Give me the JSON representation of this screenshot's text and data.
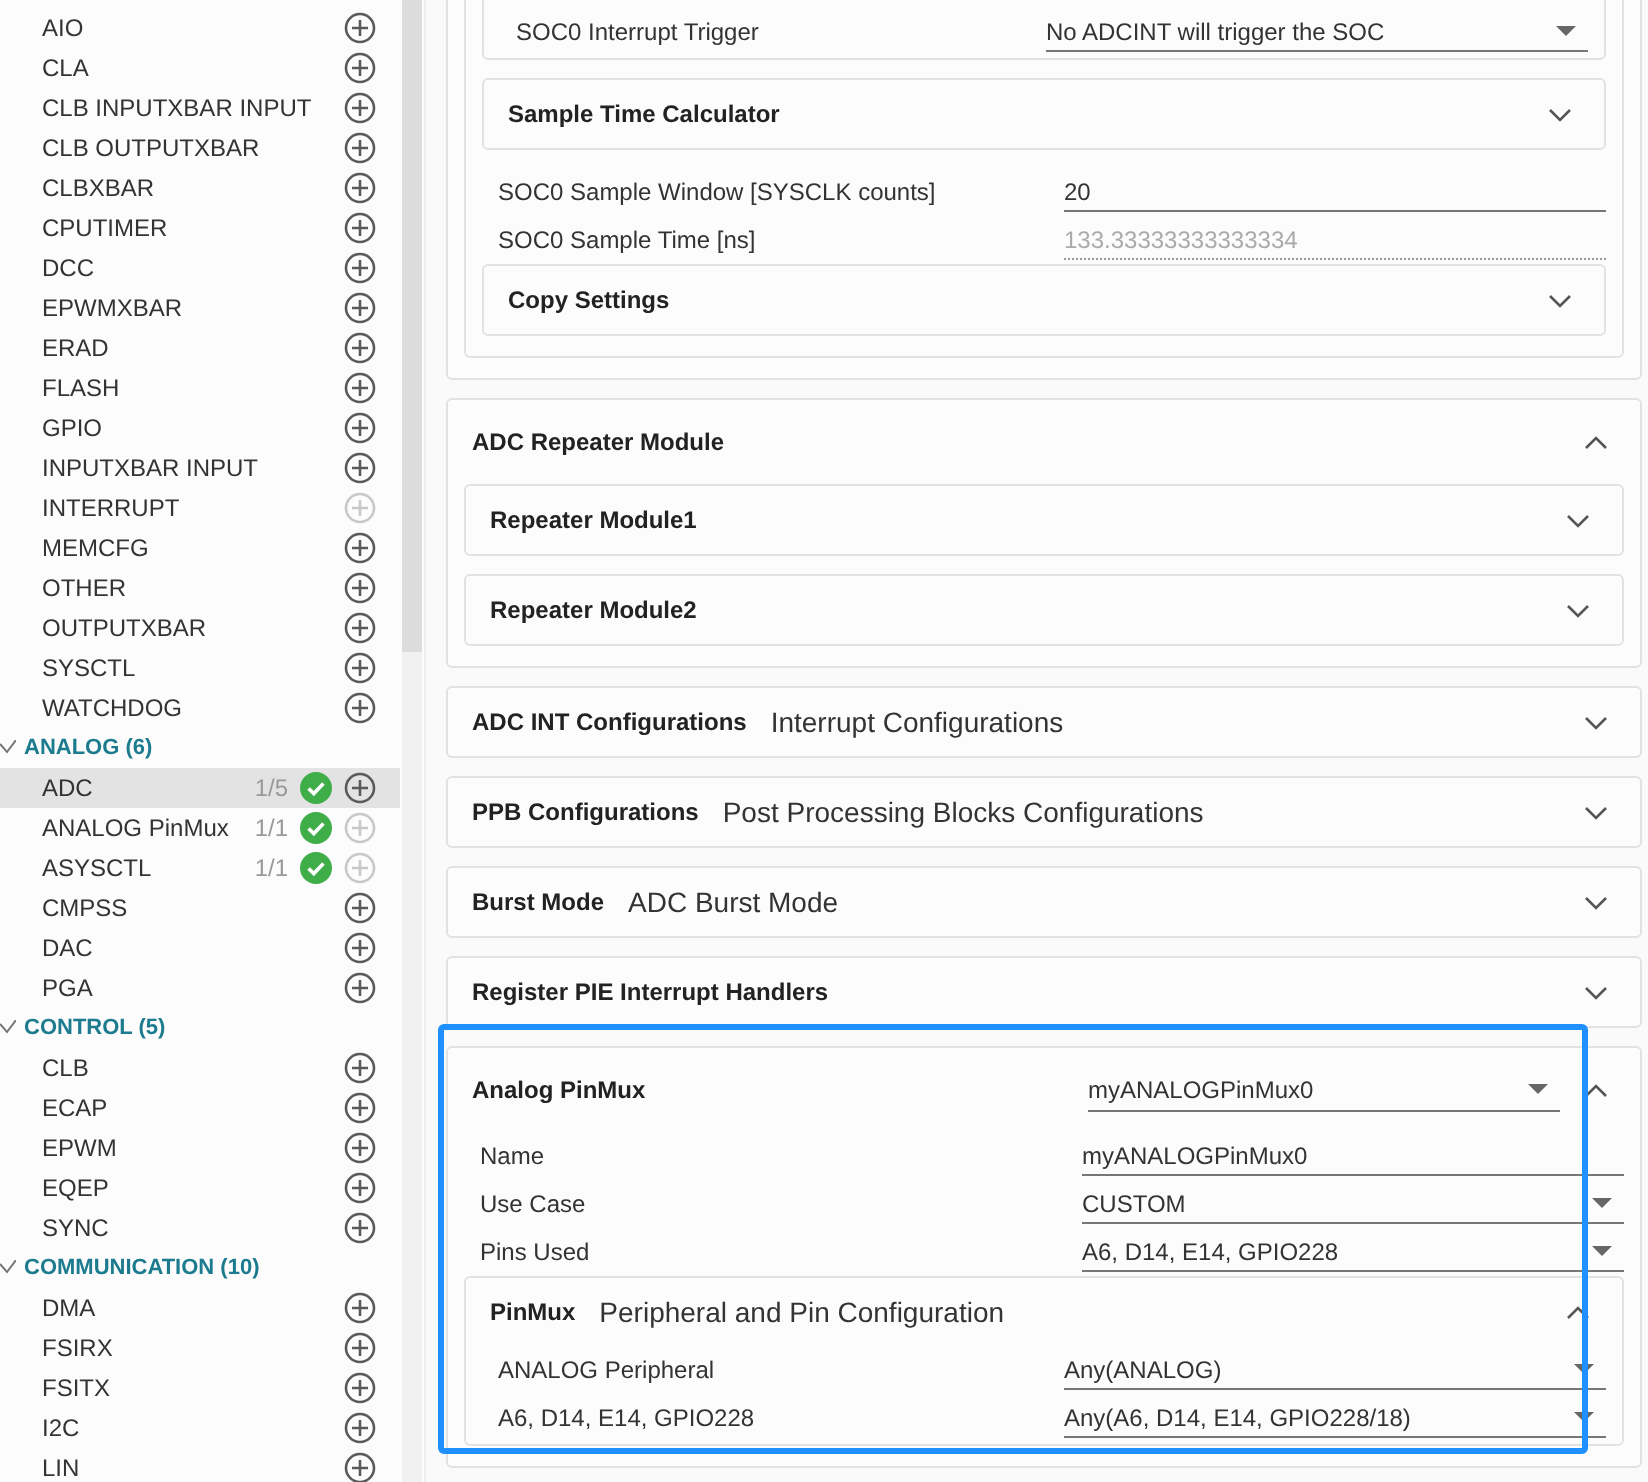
{
  "sidebar": {
    "groups": [
      {
        "items": [
          {
            "label": "AIO",
            "selected": false,
            "configured": false,
            "add_disabled": false
          },
          {
            "label": "CLA",
            "selected": false,
            "configured": false,
            "add_disabled": false
          },
          {
            "label": "CLB INPUTXBAR INPUT",
            "selected": false,
            "configured": false,
            "add_disabled": false
          },
          {
            "label": "CLB OUTPUTXBAR",
            "selected": false,
            "configured": false,
            "add_disabled": false
          },
          {
            "label": "CLBXBAR",
            "selected": false,
            "configured": false,
            "add_disabled": false
          },
          {
            "label": "CPUTIMER",
            "selected": false,
            "configured": false,
            "add_disabled": false
          },
          {
            "label": "DCC",
            "selected": false,
            "configured": false,
            "add_disabled": false
          },
          {
            "label": "EPWMXBAR",
            "selected": false,
            "configured": false,
            "add_disabled": false
          },
          {
            "label": "ERAD",
            "selected": false,
            "configured": false,
            "add_disabled": false
          },
          {
            "label": "FLASH",
            "selected": false,
            "configured": false,
            "add_disabled": false
          },
          {
            "label": "GPIO",
            "selected": false,
            "configured": false,
            "add_disabled": false
          },
          {
            "label": "INPUTXBAR INPUT",
            "selected": false,
            "configured": false,
            "add_disabled": false
          },
          {
            "label": "INTERRUPT",
            "selected": false,
            "configured": false,
            "add_disabled": true
          },
          {
            "label": "MEMCFG",
            "selected": false,
            "configured": false,
            "add_disabled": false
          },
          {
            "label": "OTHER",
            "selected": false,
            "configured": false,
            "add_disabled": false
          },
          {
            "label": "OUTPUTXBAR",
            "selected": false,
            "configured": false,
            "add_disabled": false
          },
          {
            "label": "SYSCTL",
            "selected": false,
            "configured": false,
            "add_disabled": false
          },
          {
            "label": "WATCHDOG",
            "selected": false,
            "configured": false,
            "add_disabled": false
          }
        ]
      },
      {
        "title": "ANALOG (6)",
        "expanded": true,
        "items": [
          {
            "label": "ADC",
            "selected": true,
            "count": "1/5",
            "configured": true,
            "add_disabled": false
          },
          {
            "label": "ANALOG PinMux",
            "selected": false,
            "count": "1/1",
            "configured": true,
            "add_disabled": true
          },
          {
            "label": "ASYSCTL",
            "selected": false,
            "count": "1/1",
            "configured": true,
            "add_disabled": true
          },
          {
            "label": "CMPSS",
            "selected": false,
            "configured": false,
            "add_disabled": false
          },
          {
            "label": "DAC",
            "selected": false,
            "configured": false,
            "add_disabled": false
          },
          {
            "label": "PGA",
            "selected": false,
            "configured": false,
            "add_disabled": false
          }
        ]
      },
      {
        "title": "CONTROL (5)",
        "expanded": true,
        "items": [
          {
            "label": "CLB",
            "selected": false,
            "configured": false,
            "add_disabled": false
          },
          {
            "label": "ECAP",
            "selected": false,
            "configured": false,
            "add_disabled": false
          },
          {
            "label": "EPWM",
            "selected": false,
            "configured": false,
            "add_disabled": false
          },
          {
            "label": "EQEP",
            "selected": false,
            "configured": false,
            "add_disabled": false
          },
          {
            "label": "SYNC",
            "selected": false,
            "configured": false,
            "add_disabled": false
          }
        ]
      },
      {
        "title": "COMMUNICATION (10)",
        "expanded": true,
        "items": [
          {
            "label": "DMA",
            "selected": false,
            "configured": false,
            "add_disabled": false
          },
          {
            "label": "FSIRX",
            "selected": false,
            "configured": false,
            "add_disabled": false
          },
          {
            "label": "FSITX",
            "selected": false,
            "configured": false,
            "add_disabled": false
          },
          {
            "label": "I2C",
            "selected": false,
            "configured": false,
            "add_disabled": false
          },
          {
            "label": "LIN",
            "selected": false,
            "configured": false,
            "add_disabled": false
          }
        ]
      }
    ]
  },
  "main": {
    "sections": [
      {
        "kind": "card",
        "children": [
          {
            "kind": "card",
            "children": [
              {
                "kind": "card",
                "children": [
                  {
                    "kind": "select",
                    "label": "SOC0 Interrupt Trigger",
                    "value": "No ADCINT will trigger the SOC"
                  }
                ]
              },
              {
                "kind": "card",
                "title": "Sample Time Calculator",
                "expanded": false
              },
              {
                "kind": "text",
                "label": "SOC0 Sample Window [SYSCLK counts]",
                "value": "20"
              },
              {
                "kind": "readonly",
                "label": "SOC0 Sample Time [ns]",
                "value": "133.33333333333334"
              },
              {
                "kind": "card",
                "title": "Copy Settings",
                "expanded": false
              }
            ]
          }
        ]
      },
      {
        "kind": "card",
        "title": "ADC Repeater Module",
        "expanded": true,
        "children": [
          {
            "kind": "card",
            "title": "Repeater Module1",
            "expanded": false
          },
          {
            "kind": "card",
            "title": "Repeater Module2",
            "expanded": false
          }
        ]
      },
      {
        "kind": "card",
        "title": "ADC INT Configurations",
        "subtitle": "Interrupt Configurations",
        "expanded": false
      },
      {
        "kind": "card",
        "title": "PPB Configurations",
        "subtitle": "Post Processing Blocks Configurations",
        "expanded": false
      },
      {
        "kind": "card",
        "title": "Burst Mode",
        "subtitle": "ADC Burst Mode",
        "expanded": false
      },
      {
        "kind": "card",
        "title": "Register PIE Interrupt Handlers",
        "expanded": false
      },
      {
        "kind": "card",
        "title": "Analog PinMux",
        "header_select": "myANALOGPinMux0",
        "expanded": true,
        "highlighted": true,
        "children": [
          {
            "kind": "text",
            "label": "Name",
            "value": "myANALOGPinMux0"
          },
          {
            "kind": "select",
            "label": "Use Case",
            "value": "CUSTOM"
          },
          {
            "kind": "select",
            "label": "Pins Used",
            "value": "A6, D14, E14, GPIO228"
          },
          {
            "kind": "card",
            "title": "PinMux",
            "subtitle": "Peripheral and Pin Configuration",
            "expanded": true,
            "children": [
              {
                "kind": "select",
                "label": "ANALOG Peripheral",
                "value": "Any(ANALOG)"
              },
              {
                "kind": "select",
                "label": "A6, D14, E14, GPIO228",
                "value": "Any(A6, D14, E14, GPIO228/18)"
              }
            ]
          }
        ]
      }
    ]
  }
}
